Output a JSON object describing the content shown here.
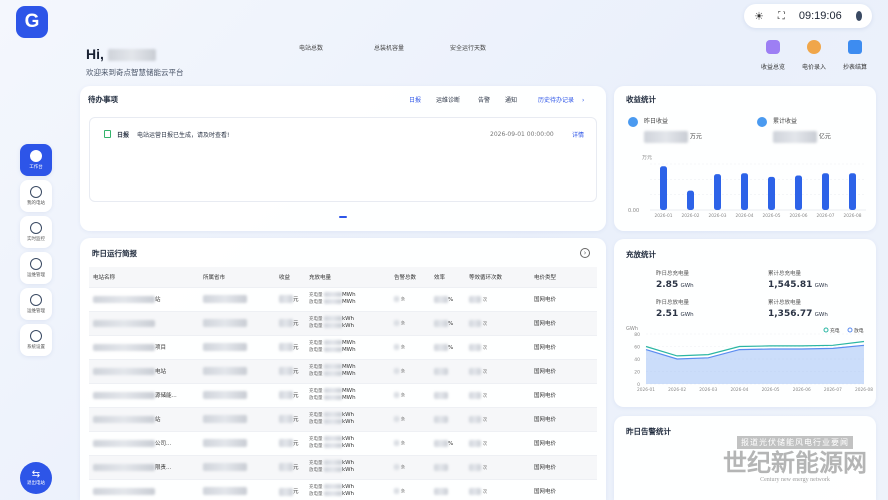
{
  "header": {
    "time": "09:19:06",
    "greeting": "Hi,",
    "welcome": "欢迎来到奇点智慧储能云平台",
    "stats": [
      "电站总数",
      "总装机容量",
      "安全运行天数"
    ],
    "quick_actions": [
      {
        "label": "收益总览",
        "color": "#8f6bf2",
        "icon": "wallet-icon"
      },
      {
        "label": "电价录入",
        "color": "#f0a64a",
        "icon": "coin-icon"
      },
      {
        "label": "抄表结算",
        "color": "#3d8cf0",
        "icon": "meter-icon"
      }
    ]
  },
  "sidebar": {
    "items": [
      {
        "label": "工作台",
        "icon": "cube-icon",
        "active": true
      },
      {
        "label": "我的电站",
        "icon": "station-icon"
      },
      {
        "label": "实时监控",
        "icon": "monitor-icon"
      },
      {
        "label": "运维管理",
        "icon": "ops-icon"
      },
      {
        "label": "运维管理",
        "icon": "network-icon"
      },
      {
        "label": "系统设置",
        "icon": "settings-icon"
      }
    ],
    "bottom_label": "退出电站"
  },
  "todo": {
    "title": "待办事项",
    "tabs": [
      "日报",
      "运维诊断",
      "告警",
      "通知"
    ],
    "history": "历史待办记录",
    "items": [
      {
        "tag": "日报",
        "text": "电站运营日报已生成，请及时查看!",
        "time": "2026-09-01 00:00:00",
        "action": "详情"
      }
    ]
  },
  "income": {
    "title": "收益统计",
    "yesterday_label": "昨日收益",
    "yesterday_unit": "万元",
    "total_label": "累计收益",
    "total_unit": "亿元",
    "unit": "万元",
    "chart_data": {
      "type": "bar",
      "categories": [
        "2026-01",
        "2026-02",
        "2026-03",
        "2026-04",
        "2026-05",
        "2026-06",
        "2026-07",
        "2026-08"
      ],
      "values": [
        0.95,
        0.42,
        0.78,
        0.8,
        0.72,
        0.75,
        0.8,
        0.8
      ],
      "ylabel": "万元",
      "yticks": [
        "0.00"
      ]
    }
  },
  "charge": {
    "title": "充放统计",
    "yesterday_charge_label": "昨日总充电量",
    "yesterday_charge": "2.85",
    "total_charge_label": "累计总充电量",
    "total_charge": "1,545.81",
    "yesterday_discharge_label": "昨日总放电量",
    "yesterday_discharge": "2.51",
    "total_discharge_label": "累计总放电量",
    "total_discharge": "1,356.77",
    "unit": "GWh",
    "chart_data": {
      "type": "line",
      "categories": [
        "2026-01",
        "2026-02",
        "2026-03",
        "2026-04",
        "2026-05",
        "2026-06",
        "2026-07",
        "2026-08"
      ],
      "series": [
        {
          "name": "充电",
          "values": [
            60,
            45,
            47,
            60,
            61,
            61,
            62,
            68
          ],
          "color": "#2bb6a3"
        },
        {
          "name": "放电",
          "values": [
            55,
            40,
            42,
            55,
            56,
            56,
            57,
            62
          ],
          "color": "#5b8cf0"
        }
      ],
      "ylabel": "GWh",
      "yticks": [
        "80",
        "60",
        "40",
        "20",
        "0"
      ],
      "ylim": [
        0,
        80
      ]
    }
  },
  "report": {
    "title": "昨日运行简报",
    "columns": [
      "电站名称",
      "所属省市",
      "收益",
      "充放电量",
      "告警总数",
      "效率",
      "等效循环次数",
      "电价类型"
    ],
    "rows": [
      {
        "name": "站",
        "income_unit": "元",
        "charge_label": "充电量",
        "discharge_label": "放电量",
        "energy_unit": "MWh",
        "alarm_unit": "条",
        "eff": "%",
        "cycle_unit": "次",
        "price": "国网电价"
      },
      {
        "name": "",
        "income_unit": "元",
        "charge_label": "充电量",
        "discharge_label": "放电量",
        "energy_unit": "kWh",
        "alarm_unit": "条",
        "eff": "%",
        "cycle_unit": "次",
        "price": "国网电价"
      },
      {
        "name": "项目",
        "income_unit": "元",
        "charge_label": "充电量",
        "discharge_label": "放电量",
        "energy_unit": "MWh",
        "alarm_unit": "条",
        "eff": "%",
        "cycle_unit": "次",
        "price": "国网电价"
      },
      {
        "name": "电站",
        "income_unit": "元",
        "charge_label": "充电量",
        "discharge_label": "放电量",
        "energy_unit": "MWh",
        "alarm_unit": "条",
        "eff": "",
        "cycle_unit": "次",
        "price": "国网电价"
      },
      {
        "name": "源储能...",
        "income_unit": "元",
        "charge_label": "充电量",
        "discharge_label": "放电量",
        "energy_unit": "MWh",
        "alarm_unit": "条",
        "eff": "",
        "cycle_unit": "次",
        "price": "国网电价"
      },
      {
        "name": "站",
        "income_unit": "元",
        "charge_label": "充电量",
        "discharge_label": "放电量",
        "energy_unit": "kWh",
        "alarm_unit": "条",
        "eff": "",
        "cycle_unit": "次",
        "price": "国网电价"
      },
      {
        "name": "公司...",
        "income_unit": "元",
        "charge_label": "充电量",
        "discharge_label": "放电量",
        "energy_unit": "kWh",
        "alarm_unit": "条",
        "eff": "%",
        "cycle_unit": "次",
        "price": "国网电价"
      },
      {
        "name": "限责...",
        "income_unit": "元",
        "charge_label": "充电量",
        "discharge_label": "放电量",
        "energy_unit": "kWh",
        "alarm_unit": "条",
        "eff": "",
        "cycle_unit": "次",
        "price": "国网电价"
      },
      {
        "name": "",
        "income_unit": "元",
        "charge_label": "充电量",
        "discharge_label": "放电量",
        "energy_unit": "kWh",
        "alarm_unit": "条",
        "eff": "",
        "cycle_unit": "次",
        "price": "国网电价"
      }
    ]
  },
  "alarm": {
    "title": "昨日告警统计"
  },
  "watermark": {
    "line1": "报道光伏储能风电行业要闻",
    "line2": "世纪新能源网",
    "line3": "Century new energy network"
  }
}
